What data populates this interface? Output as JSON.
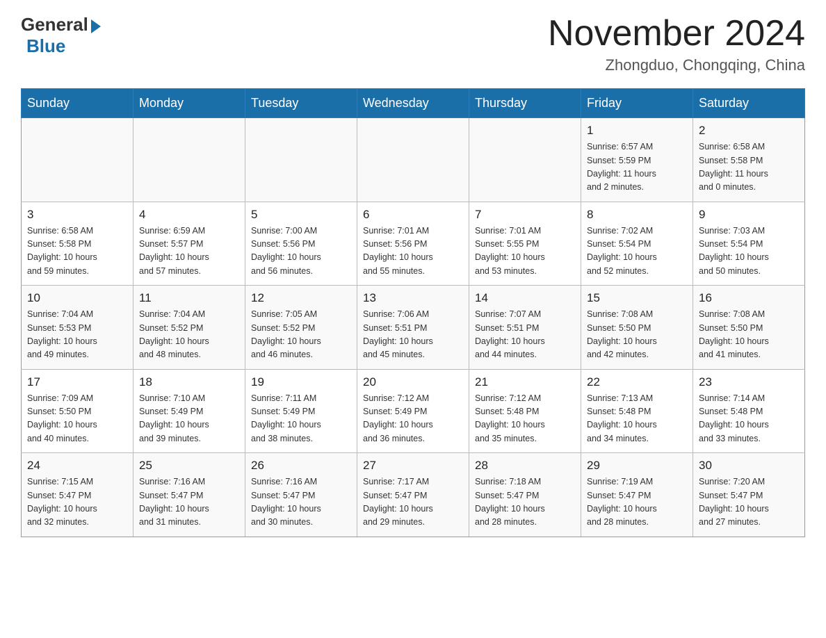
{
  "header": {
    "logo_general": "General",
    "logo_blue": "Blue",
    "month_title": "November 2024",
    "location": "Zhongduo, Chongqing, China"
  },
  "days_of_week": [
    "Sunday",
    "Monday",
    "Tuesday",
    "Wednesday",
    "Thursday",
    "Friday",
    "Saturday"
  ],
  "weeks": [
    [
      {
        "day": "",
        "info": ""
      },
      {
        "day": "",
        "info": ""
      },
      {
        "day": "",
        "info": ""
      },
      {
        "day": "",
        "info": ""
      },
      {
        "day": "",
        "info": ""
      },
      {
        "day": "1",
        "info": "Sunrise: 6:57 AM\nSunset: 5:59 PM\nDaylight: 11 hours\nand 2 minutes."
      },
      {
        "day": "2",
        "info": "Sunrise: 6:58 AM\nSunset: 5:58 PM\nDaylight: 11 hours\nand 0 minutes."
      }
    ],
    [
      {
        "day": "3",
        "info": "Sunrise: 6:58 AM\nSunset: 5:58 PM\nDaylight: 10 hours\nand 59 minutes."
      },
      {
        "day": "4",
        "info": "Sunrise: 6:59 AM\nSunset: 5:57 PM\nDaylight: 10 hours\nand 57 minutes."
      },
      {
        "day": "5",
        "info": "Sunrise: 7:00 AM\nSunset: 5:56 PM\nDaylight: 10 hours\nand 56 minutes."
      },
      {
        "day": "6",
        "info": "Sunrise: 7:01 AM\nSunset: 5:56 PM\nDaylight: 10 hours\nand 55 minutes."
      },
      {
        "day": "7",
        "info": "Sunrise: 7:01 AM\nSunset: 5:55 PM\nDaylight: 10 hours\nand 53 minutes."
      },
      {
        "day": "8",
        "info": "Sunrise: 7:02 AM\nSunset: 5:54 PM\nDaylight: 10 hours\nand 52 minutes."
      },
      {
        "day": "9",
        "info": "Sunrise: 7:03 AM\nSunset: 5:54 PM\nDaylight: 10 hours\nand 50 minutes."
      }
    ],
    [
      {
        "day": "10",
        "info": "Sunrise: 7:04 AM\nSunset: 5:53 PM\nDaylight: 10 hours\nand 49 minutes."
      },
      {
        "day": "11",
        "info": "Sunrise: 7:04 AM\nSunset: 5:52 PM\nDaylight: 10 hours\nand 48 minutes."
      },
      {
        "day": "12",
        "info": "Sunrise: 7:05 AM\nSunset: 5:52 PM\nDaylight: 10 hours\nand 46 minutes."
      },
      {
        "day": "13",
        "info": "Sunrise: 7:06 AM\nSunset: 5:51 PM\nDaylight: 10 hours\nand 45 minutes."
      },
      {
        "day": "14",
        "info": "Sunrise: 7:07 AM\nSunset: 5:51 PM\nDaylight: 10 hours\nand 44 minutes."
      },
      {
        "day": "15",
        "info": "Sunrise: 7:08 AM\nSunset: 5:50 PM\nDaylight: 10 hours\nand 42 minutes."
      },
      {
        "day": "16",
        "info": "Sunrise: 7:08 AM\nSunset: 5:50 PM\nDaylight: 10 hours\nand 41 minutes."
      }
    ],
    [
      {
        "day": "17",
        "info": "Sunrise: 7:09 AM\nSunset: 5:50 PM\nDaylight: 10 hours\nand 40 minutes."
      },
      {
        "day": "18",
        "info": "Sunrise: 7:10 AM\nSunset: 5:49 PM\nDaylight: 10 hours\nand 39 minutes."
      },
      {
        "day": "19",
        "info": "Sunrise: 7:11 AM\nSunset: 5:49 PM\nDaylight: 10 hours\nand 38 minutes."
      },
      {
        "day": "20",
        "info": "Sunrise: 7:12 AM\nSunset: 5:49 PM\nDaylight: 10 hours\nand 36 minutes."
      },
      {
        "day": "21",
        "info": "Sunrise: 7:12 AM\nSunset: 5:48 PM\nDaylight: 10 hours\nand 35 minutes."
      },
      {
        "day": "22",
        "info": "Sunrise: 7:13 AM\nSunset: 5:48 PM\nDaylight: 10 hours\nand 34 minutes."
      },
      {
        "day": "23",
        "info": "Sunrise: 7:14 AM\nSunset: 5:48 PM\nDaylight: 10 hours\nand 33 minutes."
      }
    ],
    [
      {
        "day": "24",
        "info": "Sunrise: 7:15 AM\nSunset: 5:47 PM\nDaylight: 10 hours\nand 32 minutes."
      },
      {
        "day": "25",
        "info": "Sunrise: 7:16 AM\nSunset: 5:47 PM\nDaylight: 10 hours\nand 31 minutes."
      },
      {
        "day": "26",
        "info": "Sunrise: 7:16 AM\nSunset: 5:47 PM\nDaylight: 10 hours\nand 30 minutes."
      },
      {
        "day": "27",
        "info": "Sunrise: 7:17 AM\nSunset: 5:47 PM\nDaylight: 10 hours\nand 29 minutes."
      },
      {
        "day": "28",
        "info": "Sunrise: 7:18 AM\nSunset: 5:47 PM\nDaylight: 10 hours\nand 28 minutes."
      },
      {
        "day": "29",
        "info": "Sunrise: 7:19 AM\nSunset: 5:47 PM\nDaylight: 10 hours\nand 28 minutes."
      },
      {
        "day": "30",
        "info": "Sunrise: 7:20 AM\nSunset: 5:47 PM\nDaylight: 10 hours\nand 27 minutes."
      }
    ]
  ]
}
